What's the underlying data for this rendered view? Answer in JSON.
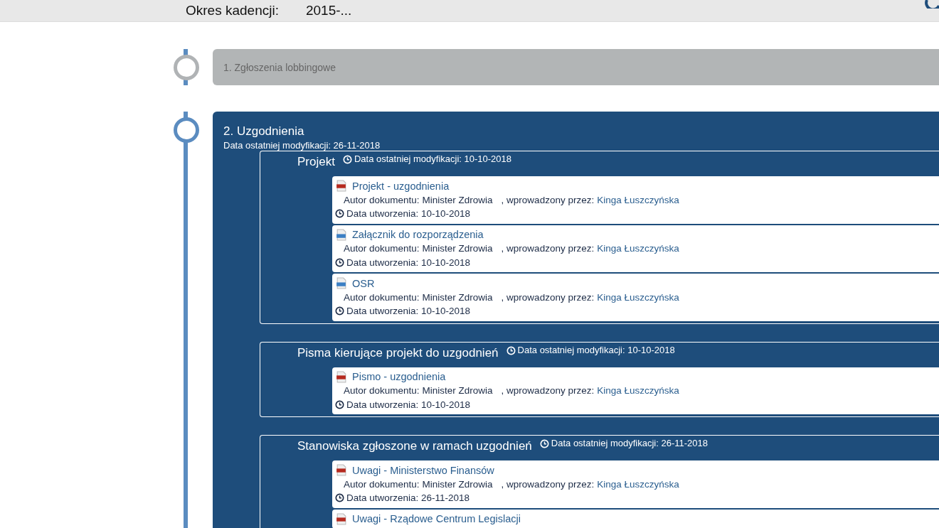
{
  "header": {
    "label": "Okres kadencji:",
    "value": "2015-..."
  },
  "stages": [
    {
      "title": "1. Zgłoszenia lobbingowe",
      "expanded": false
    },
    {
      "title": "2. Uzgodnienia",
      "expanded": true,
      "modified": "Data ostatniej modyfikacji: 26-11-2018",
      "sections": [
        {
          "title": "Projekt",
          "modified": "Data ostatniej modyfikacji: 10-10-2018",
          "documents": [
            {
              "kind": "pdf",
              "title": "Projekt - uzgodnienia",
              "author_label": "Autor dokumentu:",
              "author": "Minister Zdrowia",
              "by_label": ", wprowadzony przez:",
              "by": "Kinga Łuszczyńska",
              "created": "Data utworzenia: 10-10-2018"
            },
            {
              "kind": "file",
              "title": "Załącznik do rozporządzenia",
              "author_label": "Autor dokumentu:",
              "author": "Minister Zdrowia",
              "by_label": ", wprowadzony przez:",
              "by": "Kinga Łuszczyńska",
              "created": "Data utworzenia: 10-10-2018"
            },
            {
              "kind": "file",
              "title": "OSR",
              "author_label": "Autor dokumentu:",
              "author": "Minister Zdrowia",
              "by_label": ", wprowadzony przez:",
              "by": "Kinga Łuszczyńska",
              "created": "Data utworzenia: 10-10-2018"
            }
          ]
        },
        {
          "title": "Pisma kierujące projekt do uzgodnień",
          "modified": "Data ostatniej modyfikacji: 10-10-2018",
          "documents": [
            {
              "kind": "pdf",
              "title": "Pismo - uzgodnienia",
              "author_label": "Autor dokumentu:",
              "author": "Minister Zdrowia",
              "by_label": ", wprowadzony przez:",
              "by": "Kinga Łuszczyńska",
              "created": "Data utworzenia: 10-10-2018"
            }
          ]
        },
        {
          "title": "Stanowiska zgłoszone w ramach uzgodnień",
          "modified": "Data ostatniej modyfikacji: 26-11-2018",
          "documents": [
            {
              "kind": "pdf",
              "title": "Uwagi - Ministerstwo Finansów",
              "author_label": "Autor dokumentu:",
              "author": "Minister Zdrowia",
              "by_label": ", wprowadzony przez:",
              "by": "Kinga Łuszczyńska",
              "created": "Data utworzenia: 26-11-2018"
            },
            {
              "kind": "pdf",
              "title": "Uwagi - Rządowe Centrum Legislacji"
            }
          ]
        }
      ]
    }
  ]
}
